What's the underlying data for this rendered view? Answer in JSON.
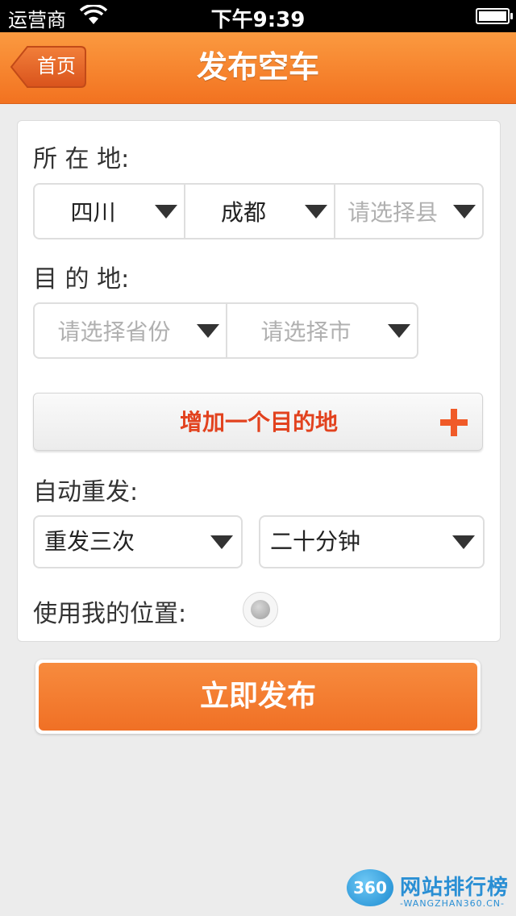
{
  "status_bar": {
    "carrier": "运营商",
    "time": "下午9:39"
  },
  "nav": {
    "back_label": "首页",
    "title": "发布空车"
  },
  "form": {
    "origin_label": "所 在 地:",
    "origin_province": "四川",
    "origin_city": "成都",
    "origin_county_placeholder": "请选择县",
    "destination_label": "目 的 地:",
    "destination_province_placeholder": "请选择省份",
    "destination_city_placeholder": "请选择市",
    "add_destination_label": "增加一个目的地",
    "auto_repost_label": "自动重发:",
    "repost_times": "重发三次",
    "repost_interval": "二十分钟",
    "use_location_label": "使用我的位置:"
  },
  "publish_label": "立即发布",
  "watermark": {
    "badge": "360",
    "name": "网站排行榜",
    "url": "-WANGZHAN360.CN-"
  },
  "colors": {
    "accent": "#f27220",
    "add_destination_text": "#e2421e",
    "plus_icon": "#f05a28"
  }
}
